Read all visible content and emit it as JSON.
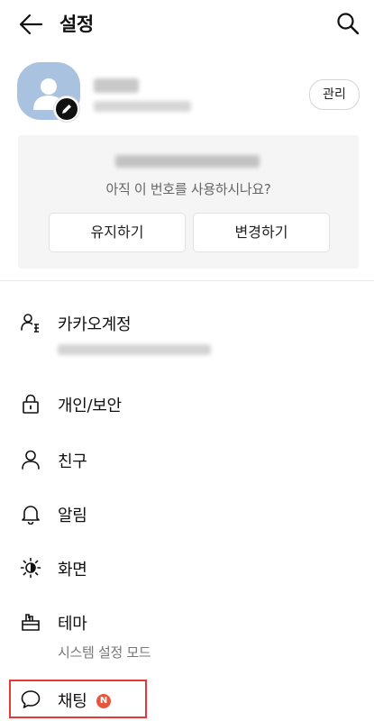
{
  "header": {
    "title": "설정",
    "back_icon": "arrow-left-icon",
    "search_icon": "search-icon"
  },
  "profile": {
    "manage_label": "관리",
    "avatar_color": "#a9c2df"
  },
  "phone_card": {
    "question": "아직 이 번호를 사용하시나요?",
    "keep_label": "유지하기",
    "change_label": "변경하기"
  },
  "menu": {
    "items": [
      {
        "label": "카카오계정",
        "icon": "account-people-icon"
      },
      {
        "label": "개인/보안",
        "icon": "lock-icon"
      },
      {
        "label": "친구",
        "icon": "person-icon"
      },
      {
        "label": "알림",
        "icon": "bell-icon"
      },
      {
        "label": "화면",
        "icon": "brightness-icon"
      },
      {
        "label": "테마",
        "icon": "brush-icon",
        "subtitle": "시스템 설정 모드"
      },
      {
        "label": "채팅",
        "icon": "chat-bubble-icon",
        "badge": "N"
      }
    ]
  },
  "colors": {
    "highlight": "#e53935",
    "new_badge": "#e8553f"
  }
}
